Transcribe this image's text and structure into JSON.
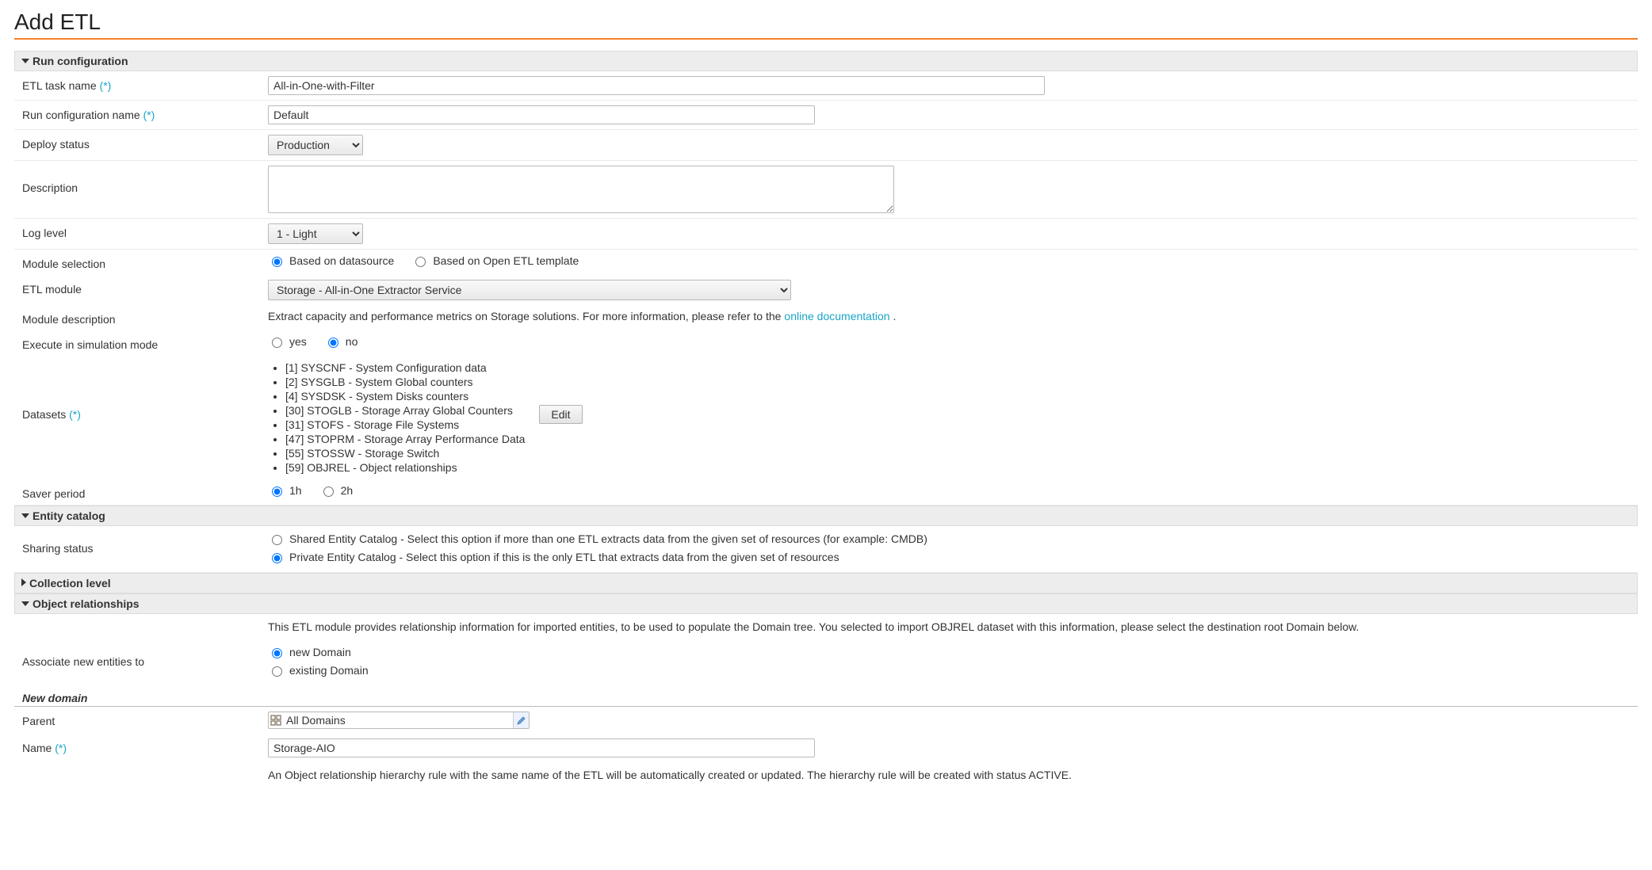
{
  "page": {
    "title": "Add ETL"
  },
  "sections": {
    "run_config": "Run configuration",
    "entity_catalog": "Entity catalog",
    "collection_level": "Collection level",
    "object_rel": "Object relationships",
    "new_domain": "New domain"
  },
  "labels": {
    "etl_task_name": "ETL task name",
    "run_config_name": "Run configuration name",
    "deploy_status": "Deploy status",
    "description": "Description",
    "log_level": "Log level",
    "module_selection": "Module selection",
    "etl_module": "ETL module",
    "module_description": "Module description",
    "execute_sim": "Execute in simulation mode",
    "datasets": "Datasets",
    "saver_period": "Saver period",
    "sharing_status": "Sharing status",
    "associate_new": "Associate new entities to",
    "parent": "Parent",
    "name": "Name",
    "req_marker": "(*)"
  },
  "values": {
    "etl_task_name": "All-in-One-with-Filter",
    "run_config_name": "Default",
    "deploy_status_selected": "Production",
    "description": "",
    "log_level_selected": "1 - Light",
    "etl_module_selected": "Storage - All-in-One Extractor Service",
    "parent": "All Domains",
    "name": "Storage-AIO"
  },
  "radios": {
    "module_selection": {
      "datasource": "Based on datasource",
      "template": "Based on Open ETL template",
      "selected": "datasource"
    },
    "execute_sim": {
      "yes": "yes",
      "no": "no",
      "selected": "no"
    },
    "saver_period": {
      "h1": "1h",
      "h2": "2h",
      "selected": "h1"
    },
    "sharing_status": {
      "shared": "Shared Entity Catalog - Select this option if more than one ETL extracts data from the given set of resources (for example: CMDB)",
      "private": "Private Entity Catalog - Select this option if this is the only ETL that extracts data from the given set of resources",
      "selected": "private"
    },
    "associate_new": {
      "new": "new Domain",
      "existing": "existing Domain",
      "selected": "new"
    }
  },
  "module_description": {
    "pre": "Extract capacity and performance metrics on Storage solutions. For more information, please refer to the ",
    "link": "online documentation",
    "post": "."
  },
  "datasets": [
    "[1] SYSCNF - System Configuration data",
    "[2] SYSGLB - System Global counters",
    "[4] SYSDSK - System Disks counters",
    "[30] STOGLB - Storage Array Global Counters",
    "[31] STOFS - Storage File Systems",
    "[47] STOPRM - Storage Array Performance Data",
    "[55] STOSSW - Storage Switch",
    "[59] OBJREL - Object relationships"
  ],
  "buttons": {
    "edit": "Edit"
  },
  "object_rel_desc": "This ETL module provides relationship information for imported entities, to be used to populate the Domain tree. You selected to import OBJREL dataset with this information, please select the destination root Domain below.",
  "hierarchy_note": "An Object relationship hierarchy rule with the same name of the ETL will be automatically created or updated. The hierarchy rule will be created with status ACTIVE."
}
